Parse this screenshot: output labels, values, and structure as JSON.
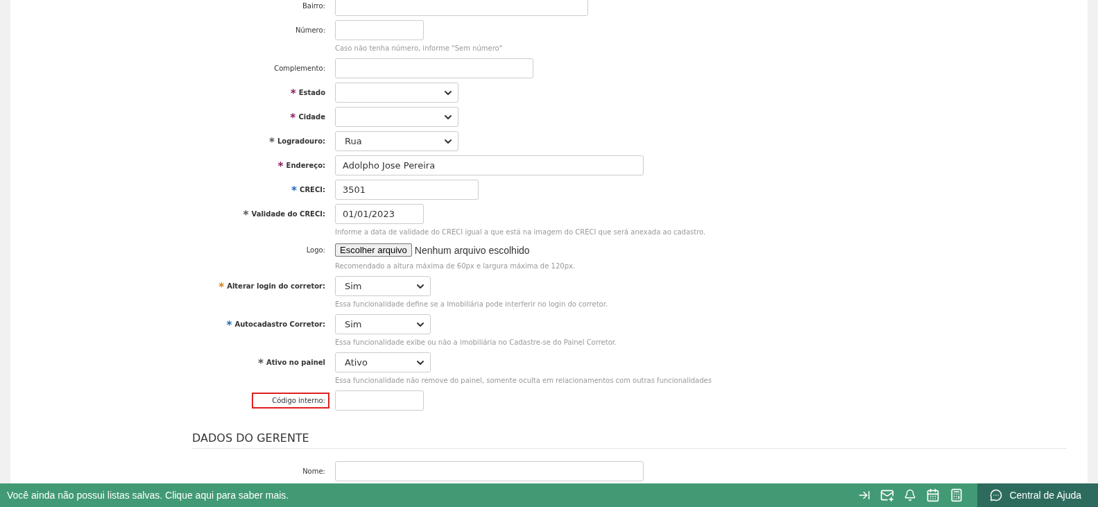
{
  "form": {
    "fields": [
      {
        "label": "Bairro:",
        "kind": "text",
        "bold": false
      },
      {
        "label": "Número:",
        "kind": "text",
        "bold": false,
        "hint": "Caso não tenha número, informe \"Sem número\""
      },
      {
        "label": "Complemento:",
        "kind": "text",
        "bold": false
      },
      {
        "label": "Estado",
        "kind": "select",
        "bold": true,
        "marker": "*",
        "color": "#8b1c62"
      },
      {
        "label": "Cidade",
        "kind": "select",
        "bold": true,
        "marker": "*",
        "color": "#8b1c62"
      },
      {
        "label": "Logradouro:",
        "kind": "select",
        "value": "Rua",
        "bold": true,
        "marker": "*",
        "color": "#555555"
      },
      {
        "label": "Endereço:",
        "kind": "text",
        "value": "Adolpho Jose Pereira",
        "bold": true,
        "marker": "*",
        "color": "#8b1c62"
      },
      {
        "label": "CRECI:",
        "kind": "text",
        "value": "3501",
        "bold": true,
        "marker": "*",
        "color": "#1e6fb8"
      },
      {
        "label": "Validade do CRECI:",
        "kind": "text",
        "value": "01/01/2023",
        "bold": true,
        "marker": "*",
        "color": "#555555",
        "hint": "Informe a data de validade do CRECI igual a que está na imagem do CRECI que será anexada ao cadastro."
      },
      {
        "label": "Logo:",
        "kind": "file",
        "button": "Escolher arquivo",
        "value": "Nenhum arquivo escolhido",
        "bold": false,
        "hint": "Recomendado a altura máxima de 60px e largura máxima de 120px."
      },
      {
        "label": "Alterar login do corretor:",
        "kind": "select",
        "value": "Sim",
        "bold": true,
        "marker": "*",
        "color": "#d9820f",
        "hint": "Essa funcionalidade define se a Imobiliária pode interferir no login do corretor."
      },
      {
        "label": "Autocadastro Corretor:",
        "kind": "select",
        "value": "Sim",
        "bold": true,
        "marker": "*",
        "color": "#1e6fb8",
        "hint": "Essa funcionalidade exibe ou não a imobiliária no Cadastre-se do Painel Corretor."
      },
      {
        "label": "Ativo no painel",
        "kind": "select",
        "value": "Ativo",
        "bold": true,
        "marker": "*",
        "color": "#555555",
        "hint": "Essa funcionalidade não remove do painel, somente oculta em relacionamentos com outras funcionalidades"
      },
      {
        "label": "Código interno:",
        "kind": "text",
        "bold": false,
        "highlighted": true
      }
    ]
  },
  "section": {
    "title": "DADOS DO GERENTE",
    "fields": [
      {
        "label": "Nome:",
        "kind": "text",
        "bold": false
      }
    ]
  },
  "bottom_bar": {
    "message": "Você ainda não possui listas salvas. Clique aqui para saber mais.",
    "help": "Central de Ajuda"
  }
}
